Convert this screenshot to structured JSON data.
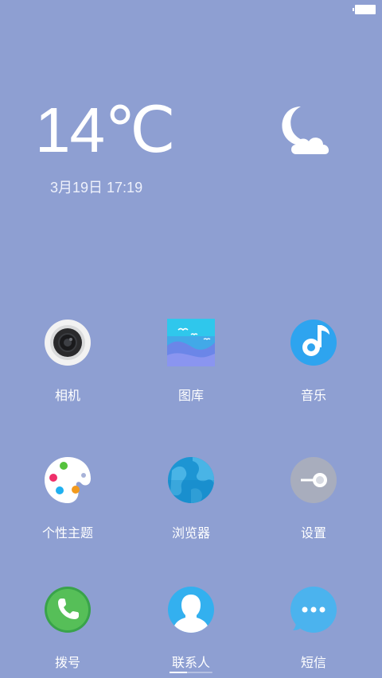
{
  "weather": {
    "temperature": "14℃",
    "date_time": "3月19日 17:19",
    "condition_icon": "moon-cloud-icon"
  },
  "apps": [
    {
      "label": "相机",
      "icon": "camera-icon"
    },
    {
      "label": "图库",
      "icon": "gallery-icon"
    },
    {
      "label": "音乐",
      "icon": "music-icon"
    },
    {
      "label": "个性主题",
      "icon": "theme-palette-icon"
    },
    {
      "label": "浏览器",
      "icon": "browser-globe-icon"
    },
    {
      "label": "设置",
      "icon": "settings-toggle-icon"
    },
    {
      "label": "拨号",
      "icon": "phone-icon"
    },
    {
      "label": "联系人",
      "icon": "contacts-icon"
    },
    {
      "label": "短信",
      "icon": "message-icon"
    }
  ],
  "page_indicator": {
    "current": 1,
    "total": 2
  },
  "colors": {
    "background": "#8e9fd2",
    "accent_blue": "#2ea4ef",
    "phone_green": "#4aaf4d"
  }
}
